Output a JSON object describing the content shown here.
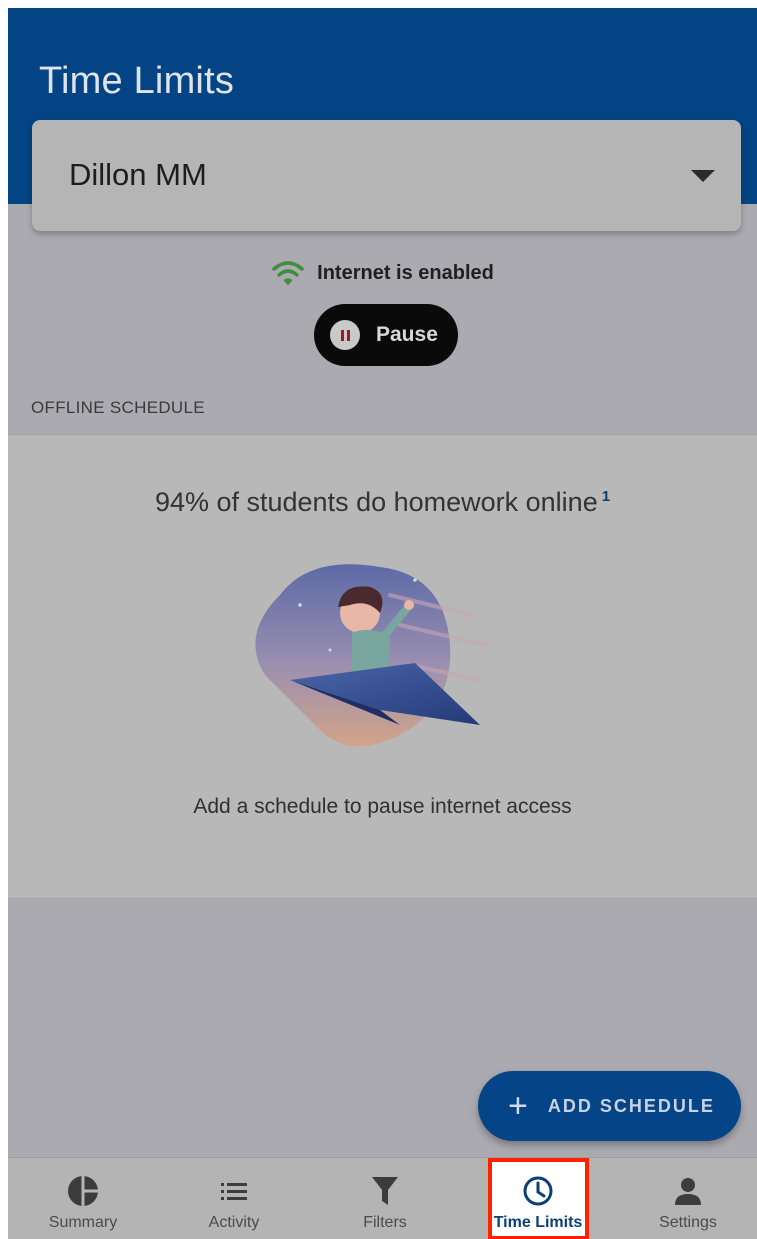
{
  "header": {
    "title": "Time Limits"
  },
  "device_select": {
    "selected": "Dillon MM"
  },
  "status": {
    "text": "Internet is enabled",
    "color": "#3e8e3e"
  },
  "pause_button": {
    "label": "Pause"
  },
  "offline_schedule": {
    "section_label": "OFFLINE SCHEDULE",
    "stat_text": "94% of students do homework online",
    "stat_footnote": "1",
    "caption": "Add a schedule to pause internet access"
  },
  "fab": {
    "label": "ADD SCHEDULE",
    "icon": "plus-icon"
  },
  "bottom_nav": {
    "items": [
      {
        "label": "Summary",
        "icon": "pie-chart-icon"
      },
      {
        "label": "Activity",
        "icon": "list-icon"
      },
      {
        "label": "Filters",
        "icon": "filter-icon"
      },
      {
        "label": "Time Limits",
        "icon": "clock-icon",
        "active": true
      },
      {
        "label": "Settings",
        "icon": "person-icon"
      }
    ]
  },
  "colors": {
    "primary": "#044485",
    "active_outline": "#ff2200"
  }
}
